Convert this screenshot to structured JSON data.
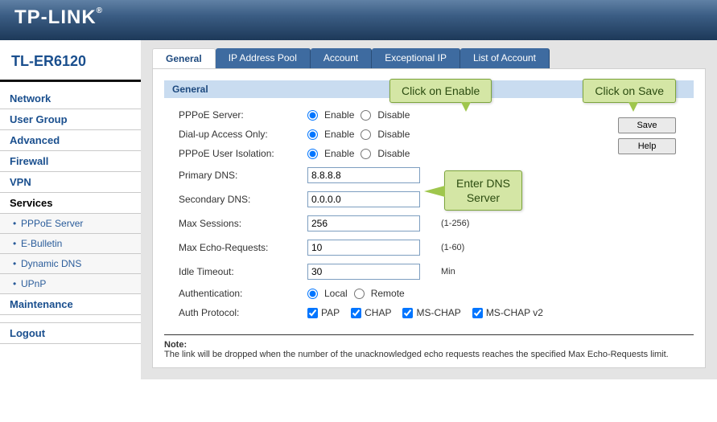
{
  "brand": "TP-LINK",
  "model": "TL-ER6120",
  "sidebar": {
    "items": [
      "Network",
      "User Group",
      "Advanced",
      "Firewall",
      "VPN",
      "Services"
    ],
    "services_sub": [
      "PPPoE Server",
      "E-Bulletin",
      "Dynamic DNS",
      "UPnP"
    ],
    "items2": [
      "Maintenance"
    ],
    "logout": "Logout"
  },
  "tabs": [
    "General",
    "IP Address Pool",
    "Account",
    "Exceptional IP",
    "List of Account"
  ],
  "section_title": "General",
  "fields": {
    "pppoe_server": {
      "label": "PPPoE Server:",
      "enable": "Enable",
      "disable": "Disable",
      "value": "enable"
    },
    "dial_up": {
      "label": "Dial-up Access Only:",
      "enable": "Enable",
      "disable": "Disable",
      "value": "enable"
    },
    "isolation": {
      "label": "PPPoE User Isolation:",
      "enable": "Enable",
      "disable": "Disable",
      "value": "enable"
    },
    "primary_dns": {
      "label": "Primary DNS:",
      "value": "8.8.8.8"
    },
    "secondary_dns": {
      "label": "Secondary DNS:",
      "value": "0.0.0.0"
    },
    "max_sessions": {
      "label": "Max Sessions:",
      "value": "256",
      "hint": "(1-256)"
    },
    "max_echo": {
      "label": "Max Echo-Requests:",
      "value": "10",
      "hint": "(1-60)"
    },
    "idle": {
      "label": "Idle Timeout:",
      "value": "30",
      "hint": "Min"
    },
    "auth": {
      "label": "Authentication:",
      "local": "Local",
      "remote": "Remote",
      "value": "local"
    },
    "protocol": {
      "label": "Auth Protocol:",
      "pap": "PAP",
      "chap": "CHAP",
      "mschap": "MS-CHAP",
      "mschap2": "MS-CHAP v2"
    }
  },
  "buttons": {
    "save": "Save",
    "help": "Help"
  },
  "note_title": "Note:",
  "note_text": "The link will be dropped when the number of the unacknowledged echo requests reaches the specified Max Echo-Requests limit.",
  "callouts": {
    "c1": "Click on Enable",
    "c2": "Click on Save",
    "c3a": "Enter DNS",
    "c3b": "Server"
  }
}
